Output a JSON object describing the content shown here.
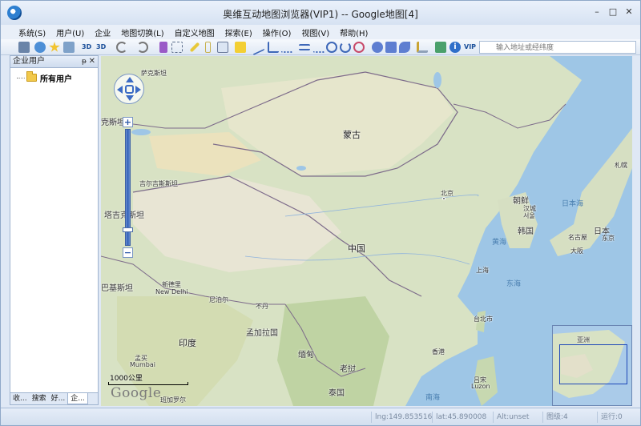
{
  "window": {
    "title": "奥维互动地图浏览器(VIP1) -- Google地图[4]",
    "minimize": "–",
    "maximize": "□",
    "close": "✕"
  },
  "menu": {
    "items": [
      "系统(S)",
      "用户(U)",
      "企业",
      "地图切换(L)",
      "自定义地图",
      "探索(E)",
      "操作(O)",
      "视图(V)",
      "帮助(H)"
    ]
  },
  "toolbar": {
    "btn_3d": "3D",
    "btn_3d2": "3D",
    "vip": "VIP",
    "search_placeholder": "输入地址或经纬度"
  },
  "sidebar": {
    "title": "企业用户",
    "pin": "ᵽ",
    "close": "✕",
    "tree_root": "所有用户",
    "tabs": [
      "收...",
      "搜索",
      "好...",
      "企..."
    ]
  },
  "map": {
    "labels": {
      "mongolia": "蒙古",
      "china": "中国",
      "india": "印度",
      "bangladesh": "孟加拉国",
      "myanmar": "缅甸",
      "laos": "老挝",
      "thailand": "泰国",
      "nepal": "尼泊尔",
      "bhutan": "不丹",
      "pakistan": "巴基斯坦",
      "kyrgyzstan": "吉尔吉斯斯坦",
      "kazakhstan_part": "克斯坦",
      "kazakhstan_top": "萨克斯坦",
      "tajik": "塔吉克斯坦",
      "beijing": "北京",
      "shanghai": "上海",
      "taipei": "台北市",
      "hongkong": "香港",
      "dprk": "朝鲜",
      "seoul_cn": "汉城",
      "seoul_en": "서울",
      "rok": "韩国",
      "japan": "日本",
      "tokyo": "东京",
      "nagoya": "名古屋",
      "osaka": "大阪",
      "sapporo": "札幌",
      "newdelhi_cn": "新德里",
      "newdelhi_en": "New Delhi",
      "mumbai_cn": "孟买",
      "mumbai_en": "Mumbai",
      "luzon_cn": "吕宋",
      "luzon_en": "Luzon",
      "bangalore": "班加罗尔",
      "sea_japan": "日本海",
      "yellow_sea": "黄海",
      "east_sea": "东海",
      "south_sea": "南海",
      "asia": "亚洲"
    },
    "scale": "1000公里",
    "logo": "Google"
  },
  "status": {
    "lng": "lng:149.853516",
    "lat": "lat:45.890008",
    "alt": "Alt:unset",
    "level": "图级:4",
    "running": "运行:0"
  }
}
